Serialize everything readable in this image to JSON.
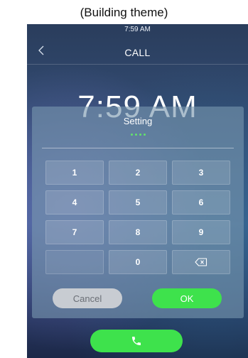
{
  "caption": "(Building theme)",
  "status_bar": {
    "time": "7:59 AM"
  },
  "header": {
    "title": "CALL"
  },
  "main": {
    "clock": "7:59 AM"
  },
  "dialog": {
    "title": "Setting",
    "password_dots_count": 4,
    "keys": [
      "1",
      "2",
      "3",
      "4",
      "5",
      "6",
      "7",
      "8",
      "9",
      "",
      "0",
      "backspace-icon"
    ],
    "cancel_label": "Cancel",
    "ok_label": "OK"
  },
  "call_button_icon": "phone-icon",
  "colors": {
    "accent_green": "#3ee24c",
    "dot_green": "#63e36b",
    "cancel_gray": "#c8ccd2"
  }
}
